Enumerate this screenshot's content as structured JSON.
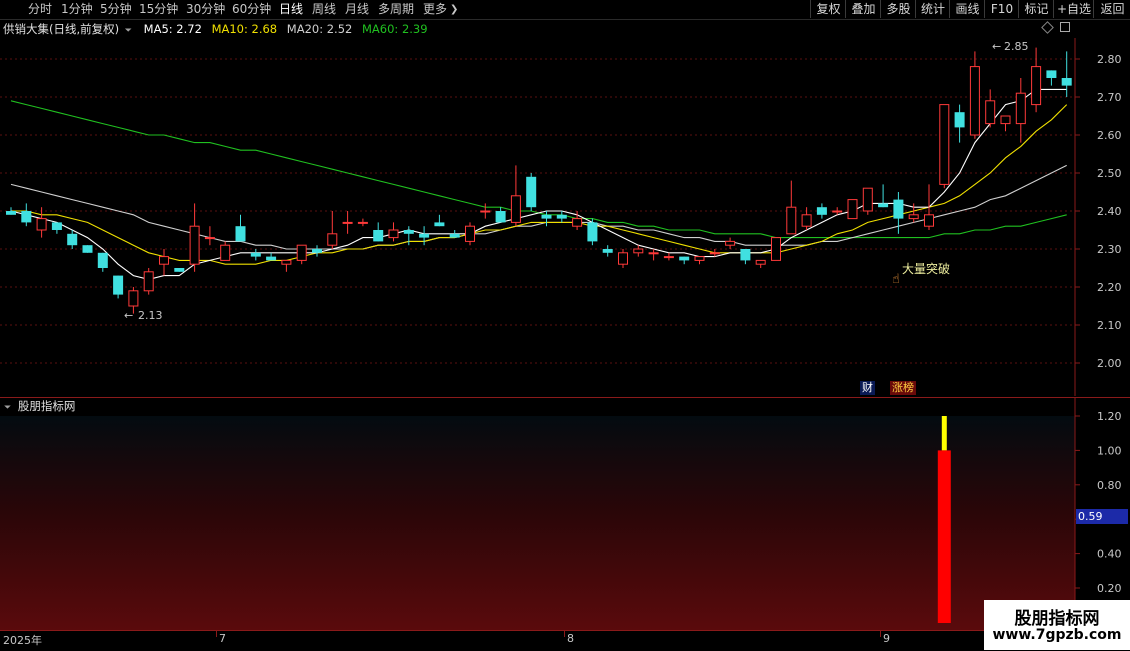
{
  "toolbar": {
    "periods": [
      "分时",
      "1分钟",
      "5分钟",
      "15分钟",
      "30分钟",
      "60分钟",
      "日线",
      "周线",
      "月线",
      "多周期",
      "更多"
    ],
    "active_period": "日线",
    "more_arrow": "❯",
    "right_buttons": [
      "复权",
      "叠加",
      "多股",
      "统计",
      "画线",
      "F10",
      "标记",
      "+自选",
      "返回"
    ]
  },
  "main": {
    "stock_name": "供销大集(日线,前复权)",
    "ma5_label": "MA5: 2.72",
    "ma10_label": "MA10: 2.68",
    "ma20_label": "MA20: 2.52",
    "ma60_label": "MA60: 2.39",
    "colors": {
      "ma5": "#ffffff",
      "ma10": "#f0e000",
      "ma20": "#d0d0d0",
      "ma60": "#20c020",
      "up": "#ff3a3a",
      "down": "#40e0e0"
    },
    "high_label": "2.85",
    "low_label": "2.13",
    "signal_label": "大量突破",
    "marker_cai": "财",
    "marker_zhang": "涨榜",
    "y_ticks": [
      "2.80",
      "2.70",
      "2.60",
      "2.50",
      "2.40",
      "2.30",
      "2.20",
      "2.10",
      "2.00"
    ]
  },
  "indicator": {
    "name": "股朋指标网",
    "value_badge": "0.59",
    "y_ticks": [
      "1.20",
      "1.00",
      "0.80",
      "0.60",
      "0.40",
      "0.20"
    ]
  },
  "date_axis": {
    "labels": [
      "2025年",
      "7",
      "8",
      "9"
    ]
  },
  "watermark": {
    "title": "股朋指标网",
    "url": "www.7gpzb.com"
  },
  "chart_data": {
    "type": "candlestick",
    "ylim": [
      1.94,
      2.86
    ],
    "candles": [
      [
        2.4,
        2.41,
        2.39,
        2.39
      ],
      [
        2.4,
        2.42,
        2.36,
        2.37
      ],
      [
        2.35,
        2.41,
        2.33,
        2.38
      ],
      [
        2.37,
        2.37,
        2.34,
        2.35
      ],
      [
        2.34,
        2.35,
        2.3,
        2.31
      ],
      [
        2.31,
        2.31,
        2.29,
        2.29
      ],
      [
        2.29,
        2.29,
        2.24,
        2.25
      ],
      [
        2.23,
        2.23,
        2.17,
        2.18
      ],
      [
        2.15,
        2.2,
        2.13,
        2.19
      ],
      [
        2.19,
        2.25,
        2.18,
        2.24
      ],
      [
        2.26,
        2.3,
        2.23,
        2.28
      ],
      [
        2.25,
        2.25,
        2.24,
        2.24
      ],
      [
        2.26,
        2.42,
        2.24,
        2.36
      ],
      [
        2.33,
        2.36,
        2.31,
        2.33
      ],
      [
        2.27,
        2.32,
        2.27,
        2.31
      ],
      [
        2.36,
        2.39,
        2.32,
        2.32
      ],
      [
        2.29,
        2.3,
        2.27,
        2.28
      ],
      [
        2.28,
        2.29,
        2.27,
        2.27
      ],
      [
        2.26,
        2.27,
        2.24,
        2.27
      ],
      [
        2.27,
        2.31,
        2.26,
        2.31
      ],
      [
        2.3,
        2.31,
        2.28,
        2.29
      ],
      [
        2.31,
        2.4,
        2.3,
        2.34
      ],
      [
        2.37,
        2.4,
        2.34,
        2.37
      ],
      [
        2.37,
        2.38,
        2.36,
        2.37
      ],
      [
        2.35,
        2.37,
        2.32,
        2.32
      ],
      [
        2.33,
        2.37,
        2.32,
        2.35
      ],
      [
        2.35,
        2.36,
        2.31,
        2.34
      ],
      [
        2.34,
        2.36,
        2.31,
        2.33
      ],
      [
        2.37,
        2.39,
        2.36,
        2.36
      ],
      [
        2.34,
        2.35,
        2.33,
        2.33
      ],
      [
        2.32,
        2.37,
        2.31,
        2.36
      ],
      [
        2.4,
        2.42,
        2.38,
        2.4
      ],
      [
        2.4,
        2.41,
        2.37,
        2.37
      ],
      [
        2.37,
        2.52,
        2.36,
        2.44
      ],
      [
        2.49,
        2.5,
        2.4,
        2.41
      ],
      [
        2.39,
        2.4,
        2.36,
        2.38
      ],
      [
        2.39,
        2.4,
        2.37,
        2.38
      ],
      [
        2.36,
        2.4,
        2.35,
        2.38
      ],
      [
        2.37,
        2.38,
        2.31,
        2.32
      ],
      [
        2.3,
        2.31,
        2.28,
        2.29
      ],
      [
        2.26,
        2.3,
        2.25,
        2.29
      ],
      [
        2.29,
        2.31,
        2.28,
        2.3
      ],
      [
        2.29,
        2.3,
        2.27,
        2.29
      ],
      [
        2.28,
        2.29,
        2.27,
        2.28
      ],
      [
        2.28,
        2.28,
        2.26,
        2.27
      ],
      [
        2.27,
        2.28,
        2.26,
        2.28
      ],
      [
        2.29,
        2.3,
        2.28,
        2.29
      ],
      [
        2.31,
        2.33,
        2.3,
        2.32
      ],
      [
        2.3,
        2.3,
        2.26,
        2.27
      ],
      [
        2.26,
        2.27,
        2.25,
        2.27
      ],
      [
        2.27,
        2.33,
        2.27,
        2.33
      ],
      [
        2.34,
        2.48,
        2.34,
        2.41
      ],
      [
        2.36,
        2.41,
        2.35,
        2.39
      ],
      [
        2.41,
        2.42,
        2.38,
        2.39
      ],
      [
        2.4,
        2.41,
        2.39,
        2.4
      ],
      [
        2.38,
        2.43,
        2.38,
        2.43
      ],
      [
        2.4,
        2.46,
        2.39,
        2.46
      ],
      [
        2.42,
        2.47,
        2.41,
        2.41
      ],
      [
        2.43,
        2.45,
        2.34,
        2.38
      ],
      [
        2.38,
        2.42,
        2.37,
        2.39
      ],
      [
        2.36,
        2.47,
        2.35,
        2.39
      ],
      [
        2.47,
        2.68,
        2.46,
        2.68
      ],
      [
        2.66,
        2.68,
        2.58,
        2.62
      ],
      [
        2.6,
        2.82,
        2.59,
        2.78
      ],
      [
        2.63,
        2.72,
        2.62,
        2.69
      ],
      [
        2.63,
        2.65,
        2.61,
        2.65
      ],
      [
        2.63,
        2.75,
        2.58,
        2.71
      ],
      [
        2.68,
        2.83,
        2.66,
        2.78
      ],
      [
        2.77,
        2.77,
        2.73,
        2.75
      ],
      [
        2.75,
        2.82,
        2.7,
        2.73
      ]
    ],
    "ma5": [
      2.4,
      2.39,
      2.38,
      2.37,
      2.35,
      2.33,
      2.3,
      2.26,
      2.23,
      2.22,
      2.23,
      2.23,
      2.26,
      2.27,
      2.28,
      2.29,
      2.29,
      2.29,
      2.29,
      2.29,
      2.29,
      2.3,
      2.31,
      2.33,
      2.33,
      2.34,
      2.35,
      2.34,
      2.34,
      2.34,
      2.34,
      2.36,
      2.37,
      2.38,
      2.39,
      2.4,
      2.4,
      2.39,
      2.37,
      2.35,
      2.33,
      2.31,
      2.3,
      2.29,
      2.29,
      2.28,
      2.28,
      2.29,
      2.29,
      2.29,
      2.3,
      2.33,
      2.35,
      2.37,
      2.39,
      2.4,
      2.42,
      2.42,
      2.42,
      2.41,
      2.41,
      2.45,
      2.5,
      2.58,
      2.63,
      2.68,
      2.69,
      2.72,
      2.72,
      2.72
    ],
    "ma10": [
      2.4,
      2.4,
      2.39,
      2.39,
      2.38,
      2.37,
      2.35,
      2.33,
      2.31,
      2.29,
      2.28,
      2.27,
      2.27,
      2.27,
      2.26,
      2.26,
      2.26,
      2.27,
      2.27,
      2.28,
      2.29,
      2.29,
      2.3,
      2.3,
      2.31,
      2.31,
      2.32,
      2.32,
      2.33,
      2.33,
      2.34,
      2.35,
      2.35,
      2.36,
      2.37,
      2.37,
      2.37,
      2.37,
      2.36,
      2.36,
      2.35,
      2.34,
      2.33,
      2.32,
      2.31,
      2.3,
      2.29,
      2.29,
      2.29,
      2.29,
      2.29,
      2.3,
      2.31,
      2.32,
      2.34,
      2.35,
      2.37,
      2.38,
      2.39,
      2.4,
      2.41,
      2.42,
      2.44,
      2.47,
      2.5,
      2.54,
      2.57,
      2.61,
      2.64,
      2.68
    ],
    "ma20": [
      2.47,
      2.46,
      2.45,
      2.44,
      2.43,
      2.42,
      2.41,
      2.4,
      2.39,
      2.37,
      2.36,
      2.35,
      2.34,
      2.33,
      2.32,
      2.32,
      2.31,
      2.31,
      2.3,
      2.3,
      2.3,
      2.3,
      2.3,
      2.3,
      2.31,
      2.31,
      2.32,
      2.32,
      2.33,
      2.33,
      2.34,
      2.34,
      2.35,
      2.36,
      2.36,
      2.37,
      2.37,
      2.37,
      2.37,
      2.36,
      2.36,
      2.35,
      2.35,
      2.34,
      2.33,
      2.33,
      2.32,
      2.32,
      2.31,
      2.31,
      2.31,
      2.31,
      2.31,
      2.32,
      2.32,
      2.33,
      2.34,
      2.35,
      2.36,
      2.37,
      2.38,
      2.39,
      2.4,
      2.41,
      2.43,
      2.44,
      2.46,
      2.48,
      2.5,
      2.52
    ],
    "ma60": [
      2.69,
      2.68,
      2.67,
      2.66,
      2.65,
      2.64,
      2.63,
      2.62,
      2.61,
      2.6,
      2.6,
      2.59,
      2.58,
      2.58,
      2.57,
      2.56,
      2.56,
      2.55,
      2.54,
      2.53,
      2.52,
      2.51,
      2.5,
      2.49,
      2.48,
      2.47,
      2.46,
      2.45,
      2.44,
      2.43,
      2.42,
      2.41,
      2.41,
      2.4,
      2.4,
      2.39,
      2.39,
      2.38,
      2.38,
      2.37,
      2.37,
      2.36,
      2.36,
      2.35,
      2.35,
      2.35,
      2.34,
      2.34,
      2.34,
      2.34,
      2.33,
      2.33,
      2.33,
      2.33,
      2.33,
      2.33,
      2.33,
      2.33,
      2.33,
      2.33,
      2.33,
      2.34,
      2.34,
      2.35,
      2.35,
      2.36,
      2.36,
      2.37,
      2.38,
      2.39
    ],
    "indicator": {
      "ylim": [
        0,
        1.32
      ],
      "bar_index": 61,
      "bar_red_value": 1.0,
      "bar_yellow_value": 1.2
    }
  }
}
